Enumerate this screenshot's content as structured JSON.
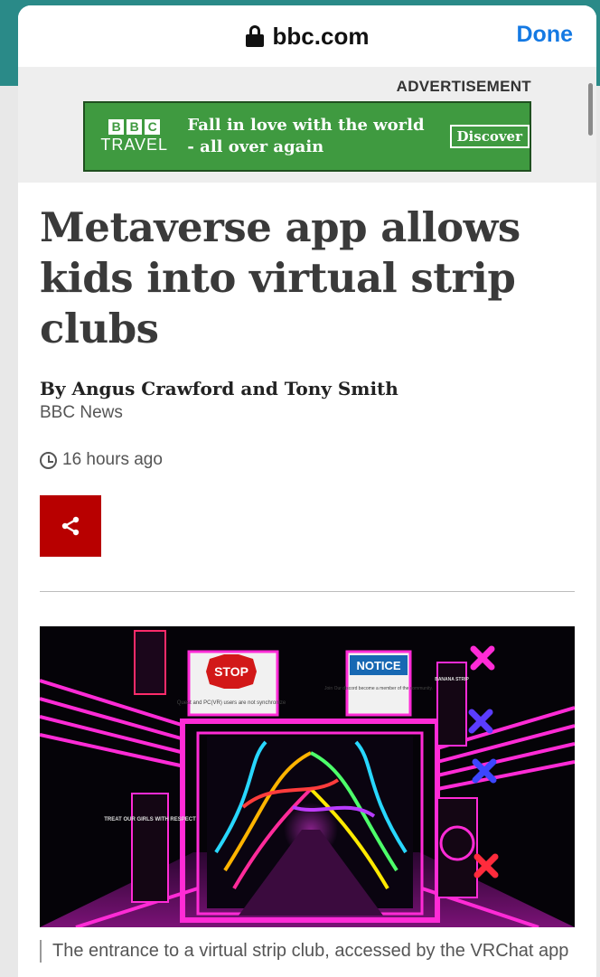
{
  "browser": {
    "url": "bbc.com",
    "done_label": "Done",
    "lock_icon": "lock-icon"
  },
  "ad": {
    "label": "ADVERTISEMENT",
    "brand_letters": [
      "B",
      "B",
      "C"
    ],
    "brand_sub": "TRAVEL",
    "tagline": "Fall in love with the world - all over again",
    "cta": "Discover",
    "colors": {
      "background": "#3f9a40",
      "text": "#ffffff"
    }
  },
  "article": {
    "headline": "Metaverse app allows kids into virtual strip clubs",
    "byline": "By Angus Crawford and Tony Smith",
    "source": "BBC News",
    "timestamp": "16 hours ago",
    "share_icon": "share-icon",
    "accent_color": "#b80000"
  },
  "figure": {
    "signs": {
      "stop_title": "STOP",
      "stop_text": "Quest and PC(VR) users are not synchronize",
      "notice_title": "NOTICE",
      "notice_text": "Join Our discord become a member of the community.",
      "left_sign": "TREAT OUR GIRLS WITH RESPECT",
      "right_sign": "BANANA STRIP"
    },
    "caption": "The entrance to a virtual strip club, accessed by the VRChat app"
  }
}
